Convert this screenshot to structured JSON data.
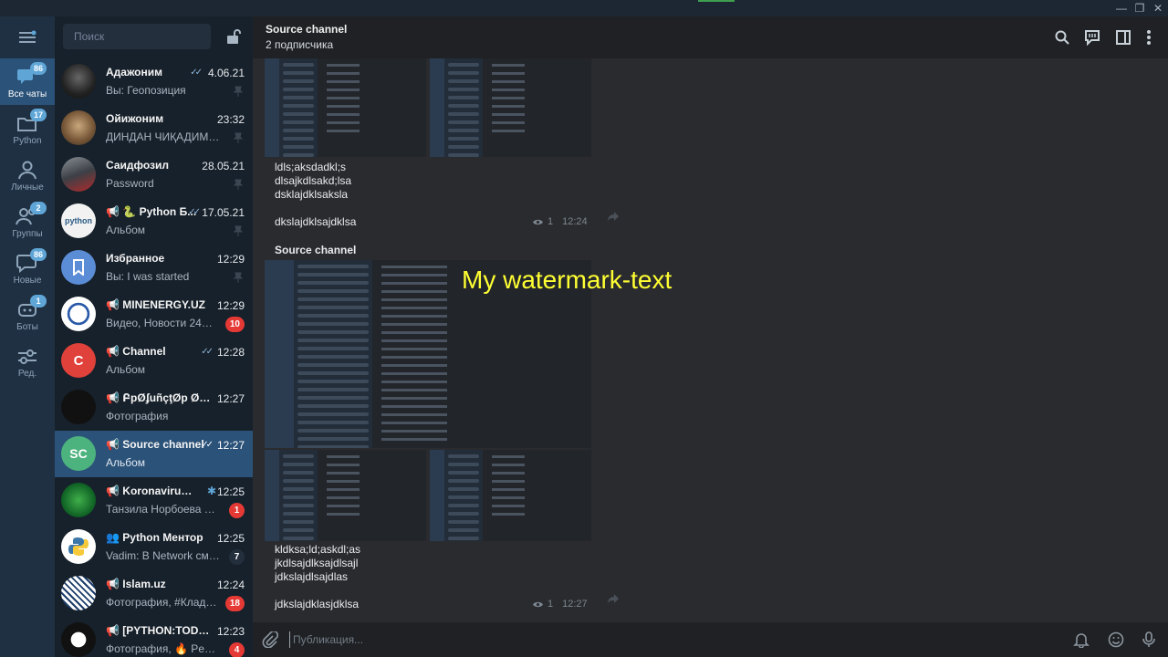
{
  "window": {
    "minimize_glyph": "—",
    "maximize_glyph": "❐",
    "close_glyph": "✕"
  },
  "rail": {
    "menu_icon": "hamburger-menu-icon",
    "folders": [
      {
        "label": "Все чаты",
        "badge": "86",
        "icon": "chat-bubbles-icon",
        "active": true
      },
      {
        "label": "Python",
        "badge": "17",
        "icon": "folder-icon",
        "active": false
      },
      {
        "label": "Личные",
        "badge": "",
        "icon": "person-icon",
        "active": false
      },
      {
        "label": "Группы",
        "badge": "2",
        "icon": "people-icon",
        "active": false
      },
      {
        "label": "Новые",
        "badge": "86",
        "icon": "chat-bubble-icon",
        "active": false
      },
      {
        "label": "Боты",
        "badge": "1",
        "icon": "robot-icon",
        "active": false
      },
      {
        "label": "Ред.",
        "badge": "",
        "icon": "sliders-icon",
        "active": false
      }
    ]
  },
  "search": {
    "placeholder": "Поиск"
  },
  "chats": [
    {
      "name": "Адажоним",
      "time": "4.06.21",
      "preview": "Вы: Геопозиция",
      "badge": "",
      "pinned": true,
      "read": true,
      "channel": false
    },
    {
      "name": "Ойижоним",
      "time": "23:32",
      "preview": "ДИНДАН ЧИҚАДИМИ ...",
      "badge": "",
      "pinned": true,
      "read": false,
      "channel": false
    },
    {
      "name": "Саидфозил",
      "time": "28.05.21",
      "preview": "Password",
      "badge": "",
      "pinned": true,
      "read": false,
      "channel": false
    },
    {
      "name": "🐍 Python Б...",
      "time": "17.05.21",
      "preview": "Альбом",
      "badge": "",
      "pinned": true,
      "read": true,
      "channel": true
    },
    {
      "name": "Избранное",
      "time": "12:29",
      "preview": "Вы: I was started",
      "badge": "",
      "pinned": true,
      "read": false,
      "channel": false
    },
    {
      "name": "MINENERGY.UZ",
      "time": "12:29",
      "preview": "Видео, Новости 24 | Э...",
      "badge": "10",
      "pinned": false,
      "read": false,
      "channel": true
    },
    {
      "name": "Channel",
      "time": "12:28",
      "preview": "Альбом",
      "badge": "",
      "pinned": false,
      "read": true,
      "channel": true
    },
    {
      "name": "ԲрØʄuñçţØр Øπτ...",
      "time": "12:27",
      "preview": "Фотография",
      "badge": "",
      "pinned": false,
      "read": false,
      "channel": true
    },
    {
      "name": "Source channel",
      "time": "12:27",
      "preview": "Альбом",
      "badge": "",
      "pinned": false,
      "read": true,
      "channel": true
    },
    {
      "name": "Koronavirus Inf...",
      "time": "12:25",
      "preview": "Танзила Норбоева АҚ...",
      "badge": "1",
      "pinned": false,
      "read": false,
      "channel": true
    },
    {
      "name": "Python Ментор",
      "time": "12:25",
      "preview": "Vadim: В Network смотр...",
      "badge": "7",
      "pinned": false,
      "read": false,
      "channel": false
    },
    {
      "name": "Islam.uz",
      "time": "12:24",
      "preview": "Фотография, #Кладезь...",
      "badge": "18",
      "pinned": false,
      "read": false,
      "channel": true
    },
    {
      "name": "[PYTHON:TODAY]",
      "time": "12:23",
      "preview": "Фотография, 🔥 Penetr...",
      "badge": "4",
      "pinned": false,
      "read": false,
      "channel": true
    }
  ],
  "avatars": {
    "izbrannoe_initial": "",
    "channel_initial": "C",
    "source_initials": "SC",
    "python_label": "python"
  },
  "header": {
    "title": "Source channel",
    "subtitle": "2 подписчика"
  },
  "messages": [
    {
      "text": "ldls;aksdadkl;s\ndlsajkdlsakd;lsa\ndsklajdklsaksla\n\ndkslajdklsajdklsа",
      "views": "1",
      "time": "12:24"
    },
    {
      "poster": "Source channel"
    },
    {
      "text": "kldksa;ld;askdl;as\njkdlsajdlksajdlsajl\njdkslajdlsajdlas\n\njdkslajdklasjdklsa",
      "views": "1",
      "time": "12:27"
    }
  ],
  "watermark": "My watermark-text",
  "composer": {
    "placeholder": "Публикация..."
  },
  "colors": {
    "accent": "#2b5278",
    "badge_red": "#e53935",
    "badge_blue": "#5fa6d7",
    "badge_muted": "#242f3d"
  }
}
